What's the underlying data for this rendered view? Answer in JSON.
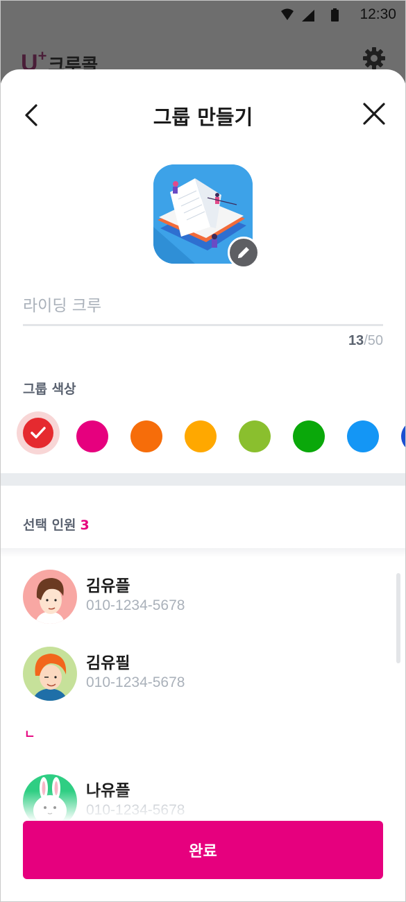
{
  "status_bar": {
    "time": "12:30"
  },
  "background_app": {
    "logo_u": "U",
    "logo_plus": "+",
    "logo_text": "크루콜"
  },
  "header": {
    "title": "그룹 만들기"
  },
  "group_name": {
    "value": "",
    "placeholder": "라이딩 크루",
    "count_now": "13",
    "count_max": "/50"
  },
  "color_section": {
    "label": "그룹 색상",
    "swatches": [
      "#e52a2f",
      "#e6007e",
      "#f66d0a",
      "#ffa800",
      "#8abf2e",
      "#0aa80a",
      "#1496f5",
      "#1b4fd1"
    ],
    "selected_index": 0
  },
  "members_section": {
    "label": "선택 인원",
    "count": "3"
  },
  "members": [
    {
      "name": "김유플",
      "phone": "010-1234-5678"
    },
    {
      "name": "김유필",
      "phone": "010-1234-5678"
    },
    {
      "name": "나유플",
      "phone": "010-1234-5678"
    }
  ],
  "section_index_letter": "ㄴ",
  "done_button": {
    "label": "완료"
  },
  "colors": {
    "accent": "#e6007e",
    "selected_swatch_ring": "#f8d6d6",
    "divider": "#e9ecef"
  }
}
